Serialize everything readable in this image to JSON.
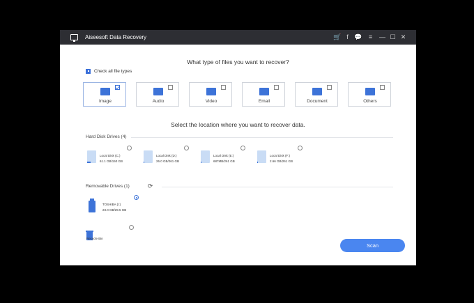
{
  "window": {
    "title": "Aiseesoft Data Recovery",
    "titlebar_icons": [
      "cart-icon",
      "facebook-icon",
      "chat-icon",
      "menu-icon",
      "minimize-icon",
      "maximize-icon",
      "close-icon"
    ],
    "titlebar_glyphs": {
      "cart": "🛒",
      "facebook": "f",
      "chat": "💬",
      "menu": "≡",
      "minimize": "—",
      "maximize": "☐",
      "close": "✕"
    }
  },
  "file_types": {
    "heading": "What type of files you want to recover?",
    "check_all_label": "Check all file types",
    "check_all_checked": true,
    "items": [
      {
        "label": "Image",
        "checked": true
      },
      {
        "label": "Audio",
        "checked": false
      },
      {
        "label": "Video",
        "checked": false
      },
      {
        "label": "Email",
        "checked": false
      },
      {
        "label": "Document",
        "checked": false
      },
      {
        "label": "Others",
        "checked": false
      }
    ]
  },
  "location": {
    "heading": "Select the location where you want to recover data.",
    "hard_disk_label": "Hard Disk Drives (4)",
    "hard_disks": [
      {
        "name": "Local Disk (C:)",
        "size": "61.1 GB/150 GB",
        "used_fraction": 0.41,
        "selected": false
      },
      {
        "name": "Local Disk (D:)",
        "size": "26.0 GB/261 GB",
        "used_fraction": 0.1,
        "selected": false
      },
      {
        "name": "Local Disk (E:)",
        "size": "687MB/261 GB",
        "used_fraction": 0.03,
        "selected": false
      },
      {
        "name": "Local Disk (F:)",
        "size": "2.66 GB/261 GB",
        "used_fraction": 0.01,
        "selected": false
      }
    ],
    "removable_label": "Removable Drives (1)",
    "removable": [
      {
        "name": "TOSHIBA (I:)",
        "size": "23.0 GB/29.5 GB",
        "selected": true
      }
    ],
    "recycle_bin_label": "Recycle Bin",
    "recycle_bin_selected": false
  },
  "scan_button_label": "Scan",
  "colors": {
    "accent": "#3d73d8",
    "scan_button": "#4a86f0",
    "titlebar": "#2d2e33"
  }
}
